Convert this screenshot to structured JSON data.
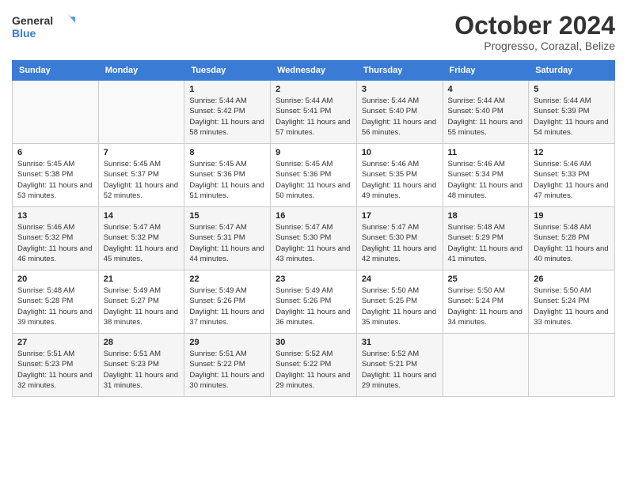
{
  "logo": {
    "general": "General",
    "blue": "Blue"
  },
  "title": "October 2024",
  "location": "Progresso, Corazal, Belize",
  "days_of_week": [
    "Sunday",
    "Monday",
    "Tuesday",
    "Wednesday",
    "Thursday",
    "Friday",
    "Saturday"
  ],
  "weeks": [
    [
      {
        "day": "",
        "info": ""
      },
      {
        "day": "",
        "info": ""
      },
      {
        "day": "1",
        "sunrise": "Sunrise: 5:44 AM",
        "sunset": "Sunset: 5:42 PM",
        "daylight": "Daylight: 11 hours and 58 minutes."
      },
      {
        "day": "2",
        "sunrise": "Sunrise: 5:44 AM",
        "sunset": "Sunset: 5:41 PM",
        "daylight": "Daylight: 11 hours and 57 minutes."
      },
      {
        "day": "3",
        "sunrise": "Sunrise: 5:44 AM",
        "sunset": "Sunset: 5:40 PM",
        "daylight": "Daylight: 11 hours and 56 minutes."
      },
      {
        "day": "4",
        "sunrise": "Sunrise: 5:44 AM",
        "sunset": "Sunset: 5:40 PM",
        "daylight": "Daylight: 11 hours and 55 minutes."
      },
      {
        "day": "5",
        "sunrise": "Sunrise: 5:44 AM",
        "sunset": "Sunset: 5:39 PM",
        "daylight": "Daylight: 11 hours and 54 minutes."
      }
    ],
    [
      {
        "day": "6",
        "sunrise": "Sunrise: 5:45 AM",
        "sunset": "Sunset: 5:38 PM",
        "daylight": "Daylight: 11 hours and 53 minutes."
      },
      {
        "day": "7",
        "sunrise": "Sunrise: 5:45 AM",
        "sunset": "Sunset: 5:37 PM",
        "daylight": "Daylight: 11 hours and 52 minutes."
      },
      {
        "day": "8",
        "sunrise": "Sunrise: 5:45 AM",
        "sunset": "Sunset: 5:36 PM",
        "daylight": "Daylight: 11 hours and 51 minutes."
      },
      {
        "day": "9",
        "sunrise": "Sunrise: 5:45 AM",
        "sunset": "Sunset: 5:36 PM",
        "daylight": "Daylight: 11 hours and 50 minutes."
      },
      {
        "day": "10",
        "sunrise": "Sunrise: 5:46 AM",
        "sunset": "Sunset: 5:35 PM",
        "daylight": "Daylight: 11 hours and 49 minutes."
      },
      {
        "day": "11",
        "sunrise": "Sunrise: 5:46 AM",
        "sunset": "Sunset: 5:34 PM",
        "daylight": "Daylight: 11 hours and 48 minutes."
      },
      {
        "day": "12",
        "sunrise": "Sunrise: 5:46 AM",
        "sunset": "Sunset: 5:33 PM",
        "daylight": "Daylight: 11 hours and 47 minutes."
      }
    ],
    [
      {
        "day": "13",
        "sunrise": "Sunrise: 5:46 AM",
        "sunset": "Sunset: 5:32 PM",
        "daylight": "Daylight: 11 hours and 46 minutes."
      },
      {
        "day": "14",
        "sunrise": "Sunrise: 5:47 AM",
        "sunset": "Sunset: 5:32 PM",
        "daylight": "Daylight: 11 hours and 45 minutes."
      },
      {
        "day": "15",
        "sunrise": "Sunrise: 5:47 AM",
        "sunset": "Sunset: 5:31 PM",
        "daylight": "Daylight: 11 hours and 44 minutes."
      },
      {
        "day": "16",
        "sunrise": "Sunrise: 5:47 AM",
        "sunset": "Sunset: 5:30 PM",
        "daylight": "Daylight: 11 hours and 43 minutes."
      },
      {
        "day": "17",
        "sunrise": "Sunrise: 5:47 AM",
        "sunset": "Sunset: 5:30 PM",
        "daylight": "Daylight: 11 hours and 42 minutes."
      },
      {
        "day": "18",
        "sunrise": "Sunrise: 5:48 AM",
        "sunset": "Sunset: 5:29 PM",
        "daylight": "Daylight: 11 hours and 41 minutes."
      },
      {
        "day": "19",
        "sunrise": "Sunrise: 5:48 AM",
        "sunset": "Sunset: 5:28 PM",
        "daylight": "Daylight: 11 hours and 40 minutes."
      }
    ],
    [
      {
        "day": "20",
        "sunrise": "Sunrise: 5:48 AM",
        "sunset": "Sunset: 5:28 PM",
        "daylight": "Daylight: 11 hours and 39 minutes."
      },
      {
        "day": "21",
        "sunrise": "Sunrise: 5:49 AM",
        "sunset": "Sunset: 5:27 PM",
        "daylight": "Daylight: 11 hours and 38 minutes."
      },
      {
        "day": "22",
        "sunrise": "Sunrise: 5:49 AM",
        "sunset": "Sunset: 5:26 PM",
        "daylight": "Daylight: 11 hours and 37 minutes."
      },
      {
        "day": "23",
        "sunrise": "Sunrise: 5:49 AM",
        "sunset": "Sunset: 5:26 PM",
        "daylight": "Daylight: 11 hours and 36 minutes."
      },
      {
        "day": "24",
        "sunrise": "Sunrise: 5:50 AM",
        "sunset": "Sunset: 5:25 PM",
        "daylight": "Daylight: 11 hours and 35 minutes."
      },
      {
        "day": "25",
        "sunrise": "Sunrise: 5:50 AM",
        "sunset": "Sunset: 5:24 PM",
        "daylight": "Daylight: 11 hours and 34 minutes."
      },
      {
        "day": "26",
        "sunrise": "Sunrise: 5:50 AM",
        "sunset": "Sunset: 5:24 PM",
        "daylight": "Daylight: 11 hours and 33 minutes."
      }
    ],
    [
      {
        "day": "27",
        "sunrise": "Sunrise: 5:51 AM",
        "sunset": "Sunset: 5:23 PM",
        "daylight": "Daylight: 11 hours and 32 minutes."
      },
      {
        "day": "28",
        "sunrise": "Sunrise: 5:51 AM",
        "sunset": "Sunset: 5:23 PM",
        "daylight": "Daylight: 11 hours and 31 minutes."
      },
      {
        "day": "29",
        "sunrise": "Sunrise: 5:51 AM",
        "sunset": "Sunset: 5:22 PM",
        "daylight": "Daylight: 11 hours and 30 minutes."
      },
      {
        "day": "30",
        "sunrise": "Sunrise: 5:52 AM",
        "sunset": "Sunset: 5:22 PM",
        "daylight": "Daylight: 11 hours and 29 minutes."
      },
      {
        "day": "31",
        "sunrise": "Sunrise: 5:52 AM",
        "sunset": "Sunset: 5:21 PM",
        "daylight": "Daylight: 11 hours and 29 minutes."
      },
      {
        "day": "",
        "info": ""
      },
      {
        "day": "",
        "info": ""
      }
    ]
  ]
}
